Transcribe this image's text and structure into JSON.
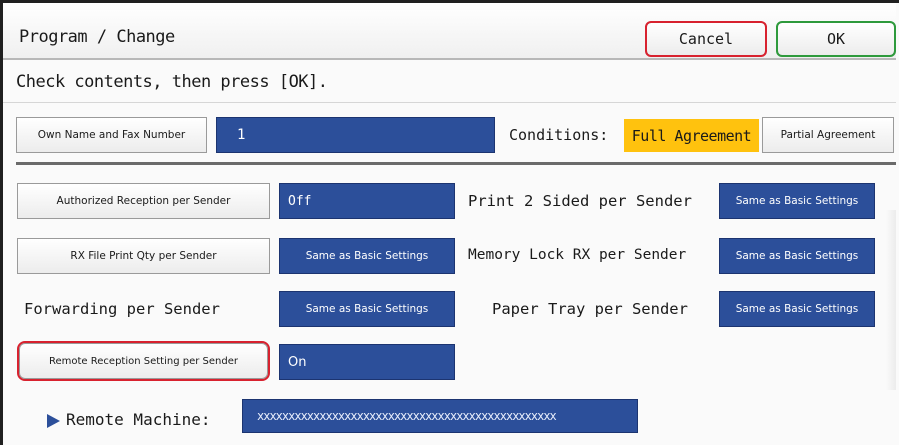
{
  "header": {
    "title": "Program / Change",
    "cancel_label": "Cancel",
    "ok_label": "OK"
  },
  "message": "Check contents, then press [OK].",
  "own_name": {
    "label": "Own Name and Fax Number",
    "value": "1"
  },
  "conditions": {
    "label": "Conditions:",
    "full_label": "Full Agreement",
    "partial_label": "Partial Agreement",
    "selected": "Full Agreement"
  },
  "settings": {
    "authorized_reception": {
      "label": "Authorized Reception per Sender",
      "value": "Off"
    },
    "print_2_sided": {
      "label": "Print 2 Sided per Sender",
      "value": "Same as Basic Settings"
    },
    "rx_file_print_qty": {
      "label": "RX File Print Qty per Sender",
      "value": "Same as Basic Settings"
    },
    "memory_lock_rx": {
      "label": "Memory Lock RX per Sender",
      "value": "Same as Basic Settings"
    },
    "forwarding": {
      "label": "Forwarding per Sender",
      "value": "Same as Basic Settings"
    },
    "paper_tray": {
      "label": "Paper Tray per Sender",
      "value": "Same as Basic Settings"
    },
    "remote_reception": {
      "label": "Remote Reception Setting per Sender",
      "value": "On"
    }
  },
  "remote_machine": {
    "label": "Remote Machine:",
    "value": "xxxxxxxxxxxxxxxxxxxxxxxxxxxxxxxxxxxxxxxxxxxxxxxx"
  },
  "colors": {
    "accent_blue": "#2c4f9a",
    "selected_yellow": "#ffc20e",
    "highlight_red": "#d8222f"
  }
}
